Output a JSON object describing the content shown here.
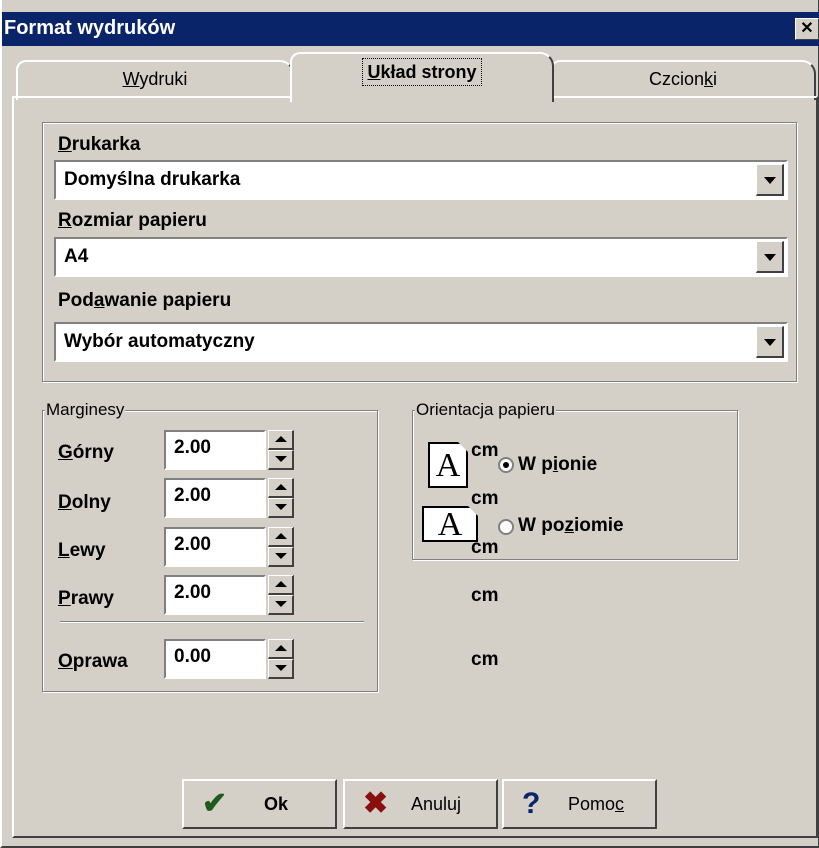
{
  "window": {
    "title": "Format wydruków",
    "close_glyph": "✕"
  },
  "tabs": [
    {
      "pre": "",
      "mnemonic": "W",
      "post": "ydruki"
    },
    {
      "pre": "",
      "mnemonic": "U",
      "post": "kład strony"
    },
    {
      "pre": "Czcion",
      "mnemonic": "k",
      "post": "i"
    }
  ],
  "printer": {
    "label_mnemonic": "D",
    "label_rest": "rukarka",
    "value": "Domyślna drukarka"
  },
  "paper_size": {
    "label_mnemonic": "R",
    "label_rest": "ozmiar papieru",
    "value": "A4"
  },
  "paper_feed": {
    "label_pre": "Pod",
    "label_mnemonic": "a",
    "label_post": "wanie papieru",
    "value": "Wybór automatyczny"
  },
  "margins": {
    "title": "Marginesy",
    "unit": "cm",
    "top": {
      "mnemonic": "G",
      "rest": "órny",
      "value": "2.00"
    },
    "bottom": {
      "mnemonic": "D",
      "rest": "olny",
      "value": "2.00"
    },
    "left": {
      "mnemonic": "L",
      "rest": "ewy",
      "value": "2.00"
    },
    "right": {
      "mnemonic": "P",
      "rest": "rawy",
      "value": "2.00"
    },
    "binding": {
      "mnemonic": "O",
      "rest": "prawa",
      "value": "0.00"
    }
  },
  "orientation": {
    "title": "Orientacja papieru",
    "icon_letter": "A",
    "portrait": {
      "pre": "W p",
      "mnemonic": "i",
      "post": "onie",
      "selected": true
    },
    "landscape": {
      "pre": "W po",
      "mnemonic": "z",
      "post": "iomie",
      "selected": false
    }
  },
  "buttons": {
    "ok": {
      "label": "Ok",
      "icon": "checkmark-icon",
      "icon_glyph": "✔",
      "icon_color": "#1e5a1e"
    },
    "cancel": {
      "label": "Anuluj",
      "icon": "x-icon",
      "icon_glyph": "✖",
      "icon_color": "#8a1010"
    },
    "help": {
      "pre": "Pomo",
      "mnemonic": "c",
      "icon": "question-icon",
      "icon_glyph": "?",
      "icon_color": "#0a246a"
    }
  }
}
